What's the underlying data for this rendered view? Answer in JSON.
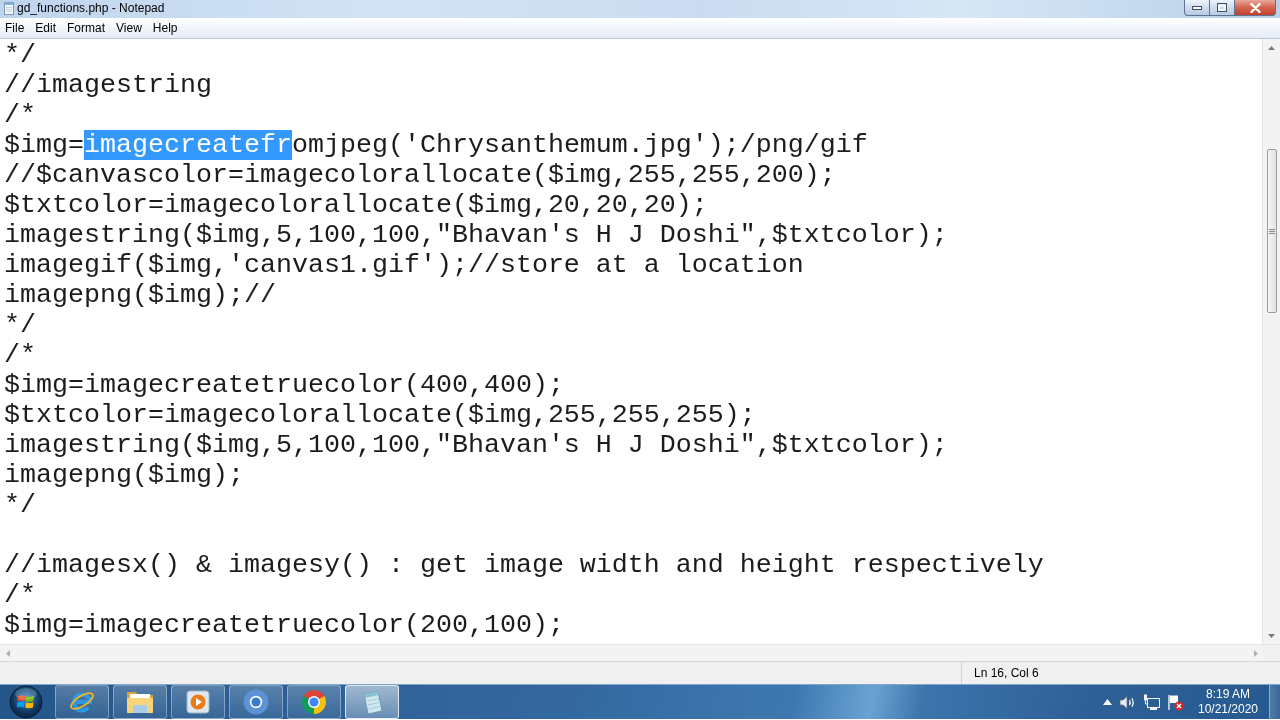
{
  "window": {
    "title": "gd_functions.php - Notepad"
  },
  "menu": [
    "File",
    "Edit",
    "Format",
    "View",
    "Help"
  ],
  "editor": {
    "lines": [
      {
        "kind": "code",
        "text": "*/"
      },
      {
        "kind": "code",
        "text": "//imagestring"
      },
      {
        "kind": "code",
        "text": "/*"
      },
      {
        "kind": "code",
        "parts": [
          {
            "text": "$img=",
            "selected": false
          },
          {
            "text": "imagecreatefr",
            "selected": true
          },
          {
            "text": "omjpeg('Chrysanthemum.jpg');/png/gif",
            "selected": false
          }
        ]
      },
      {
        "kind": "code",
        "text": "//$canvascolor=imagecolorallocate($img,255,255,200);"
      },
      {
        "kind": "code",
        "text": "$txtcolor=imagecolorallocate($img,20,20,20);"
      },
      {
        "kind": "code",
        "text": "imagestring($img,5,100,100,\"Bhavan's H J Doshi\",$txtcolor);"
      },
      {
        "kind": "code",
        "text": "imagegif($img,'canvas1.gif');//store at a location"
      },
      {
        "kind": "code",
        "text": "imagepng($img);//"
      },
      {
        "kind": "code",
        "text": "*/"
      },
      {
        "kind": "code",
        "text": "/*"
      },
      {
        "kind": "code",
        "text": "$img=imagecreatetruecolor(400,400);"
      },
      {
        "kind": "code",
        "text": "$txtcolor=imagecolorallocate($img,255,255,255);"
      },
      {
        "kind": "code",
        "text": "imagestring($img,5,100,100,\"Bhavan's H J Doshi\",$txtcolor);"
      },
      {
        "kind": "code",
        "text": "imagepng($img);"
      },
      {
        "kind": "code",
        "text": "*/"
      },
      {
        "kind": "blank"
      },
      {
        "kind": "code",
        "text": "//imagesx() & imagesy() : get image width and height respectively"
      },
      {
        "kind": "code",
        "text": "/*"
      },
      {
        "kind": "code",
        "text": "$img=imagecreatetruecolor(200,100);"
      }
    ]
  },
  "status_bar": {
    "position": "Ln 16, Col 6"
  },
  "taskbar": {
    "apps": [
      {
        "kind": "elogo",
        "selected": false
      },
      {
        "kind": "folder",
        "selected": false
      },
      {
        "kind": "player",
        "selected": false
      },
      {
        "kind": "ring",
        "selected": false
      },
      {
        "kind": "wheel",
        "selected": false
      },
      {
        "kind": "notepad",
        "selected": true
      }
    ],
    "clock": {
      "time": "8:19 AM",
      "date": "10/21/2020"
    }
  }
}
